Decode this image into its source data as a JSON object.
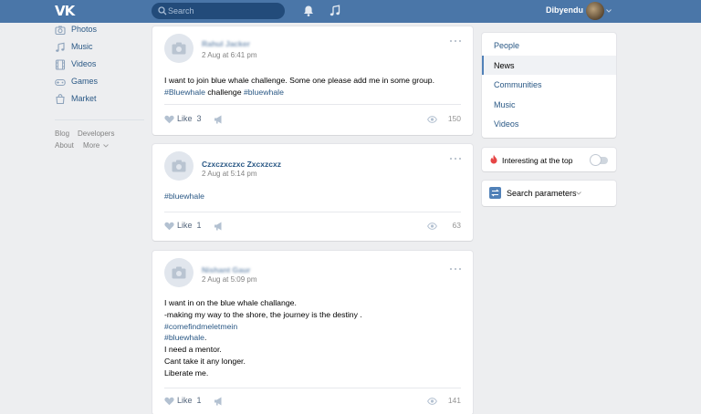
{
  "header": {
    "logo_text": "VK",
    "search_placeholder": "Search",
    "user_name": "Dibyendu"
  },
  "leftnav": {
    "items": [
      {
        "label": "Photos",
        "icon": "photos-icon"
      },
      {
        "label": "Music",
        "icon": "music-icon"
      },
      {
        "label": "Videos",
        "icon": "videos-icon"
      },
      {
        "label": "Games",
        "icon": "games-icon"
      },
      {
        "label": "Market",
        "icon": "market-icon"
      }
    ],
    "footer": {
      "blog": "Blog",
      "developers": "Developers",
      "about": "About",
      "more": "More"
    }
  },
  "posts": [
    {
      "author": "Rahul Jacker",
      "date": "2 Aug at 6:41 pm",
      "lines": [
        [
          {
            "t": "I want to join blue whale challenge. Some one please add me in some group."
          }
        ],
        [
          {
            "t": "#Bluewhale",
            "tag": true
          },
          {
            "t": " challenge "
          },
          {
            "t": "#bluewhale",
            "tag": true
          }
        ]
      ],
      "likes_label": "Like",
      "likes": "3",
      "views": "150"
    },
    {
      "author": "Czxczxczxc Zxcxzcxz",
      "date": "2 Aug at 5:14 pm",
      "lines": [
        [
          {
            "t": "#bluewhale",
            "tag": true
          }
        ]
      ],
      "likes_label": "Like",
      "likes": "1",
      "views": "63"
    },
    {
      "author": "Nishant Gaur",
      "date": "2 Aug at 5:09 pm",
      "lines": [
        [
          {
            "t": "I want in on the blue whale challange."
          }
        ],
        [
          {
            "t": "-making my way to the shore, the journey is the destiny ."
          }
        ],
        [
          {
            "t": "#comefindmeletmein",
            "tag": true
          }
        ],
        [
          {
            "t": "#bluewhale",
            "tag": true
          },
          {
            "t": "."
          }
        ],
        [
          {
            "t": "I need a mentor."
          }
        ],
        [
          {
            "t": "Cant take it any longer."
          }
        ],
        [
          {
            "t": "Liberate me."
          }
        ]
      ],
      "likes_label": "Like",
      "likes": "1",
      "views": "141"
    }
  ],
  "rightnav": {
    "items": [
      {
        "label": "People",
        "active": false
      },
      {
        "label": "News",
        "active": true
      },
      {
        "label": "Communities",
        "active": false
      },
      {
        "label": "Music",
        "active": false
      },
      {
        "label": "Videos",
        "active": false
      }
    ],
    "interesting_label": "Interesting at the top",
    "interesting_on": false,
    "search_params_label": "Search parameters"
  },
  "colors": {
    "accent": "#4a76a8",
    "link": "#2a5885",
    "bg": "#edeef0"
  }
}
